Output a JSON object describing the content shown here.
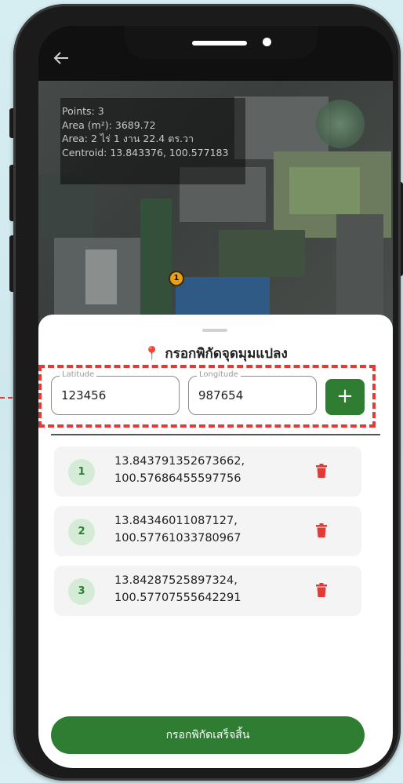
{
  "map_overlay": {
    "lines": [
      "Points: 3",
      "Area (m²): 3689.72",
      "Area: 2 ไร่ 1 งาน 22.4 ตร.วา",
      "Centroid: 13.843376, 100.577183"
    ],
    "marker_label": "1"
  },
  "sheet": {
    "title": "กรอกพิกัดจุดมุมแปลง",
    "title_icon": "pin-icon",
    "latitude": {
      "label": "Latitude",
      "value": "123456"
    },
    "longitude": {
      "label": "Longitude",
      "value": "987654"
    },
    "add_label": "+",
    "points": [
      {
        "index": "1",
        "lat": "13.843791352673662,",
        "lng": "100.57686455597756"
      },
      {
        "index": "2",
        "lat": "13.84346011087127,",
        "lng": "100.57761033780967"
      },
      {
        "index": "3",
        "lat": "13.84287525897324,",
        "lng": "100.57707555642291"
      }
    ],
    "finish_label": "กรอกพิกัดเสร็จสิ้น"
  },
  "colors": {
    "primary": "#2e7d32",
    "delete": "#e53935",
    "highlight": "#e53935"
  }
}
